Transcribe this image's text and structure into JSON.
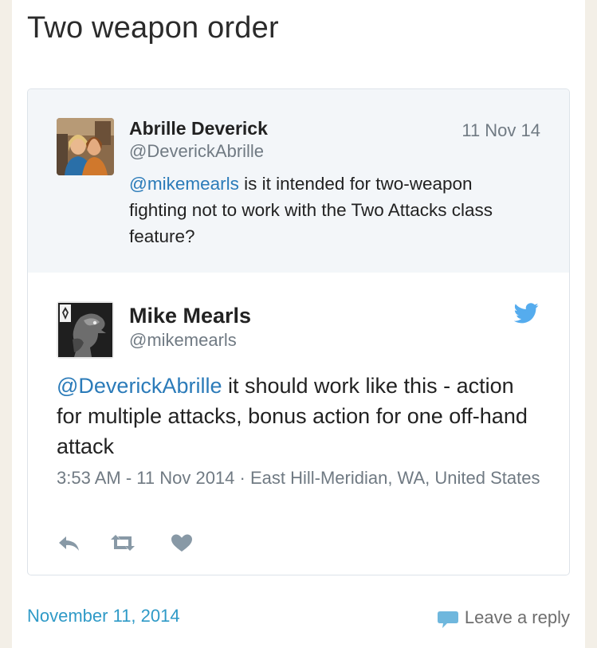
{
  "post": {
    "title": "Two weapon order",
    "date": "November 11, 2014",
    "leave_reply_label": "Leave a reply"
  },
  "embed": {
    "quoted_tweet": {
      "name": "Abrille Deverick",
      "handle": "@DeverickAbrille",
      "date": "11 Nov 14",
      "mention": "@mikemearls",
      "text": " is it intended for two-weapon fighting not to work with the Two Attacks class feature?"
    },
    "tweet": {
      "name": "Mike Mearls",
      "handle": "@mikemearls",
      "mention": "@DeverickAbrille",
      "text": " it should work like this - action for multiple attacks, bonus action for one off-hand attack",
      "meta": "3:53 AM - 11 Nov 2014 · East Hill-Meridian, WA, United States"
    },
    "actions": [
      "reply-icon",
      "retweet-icon",
      "like-icon"
    ]
  },
  "colors": {
    "link": "#2b7bb9",
    "twitter_blue": "#55acee",
    "footer_link": "#2f9ac7",
    "muted": "#707a83",
    "quoted_bg": "#f3f6f9",
    "page_bg": "#f3efe7"
  }
}
